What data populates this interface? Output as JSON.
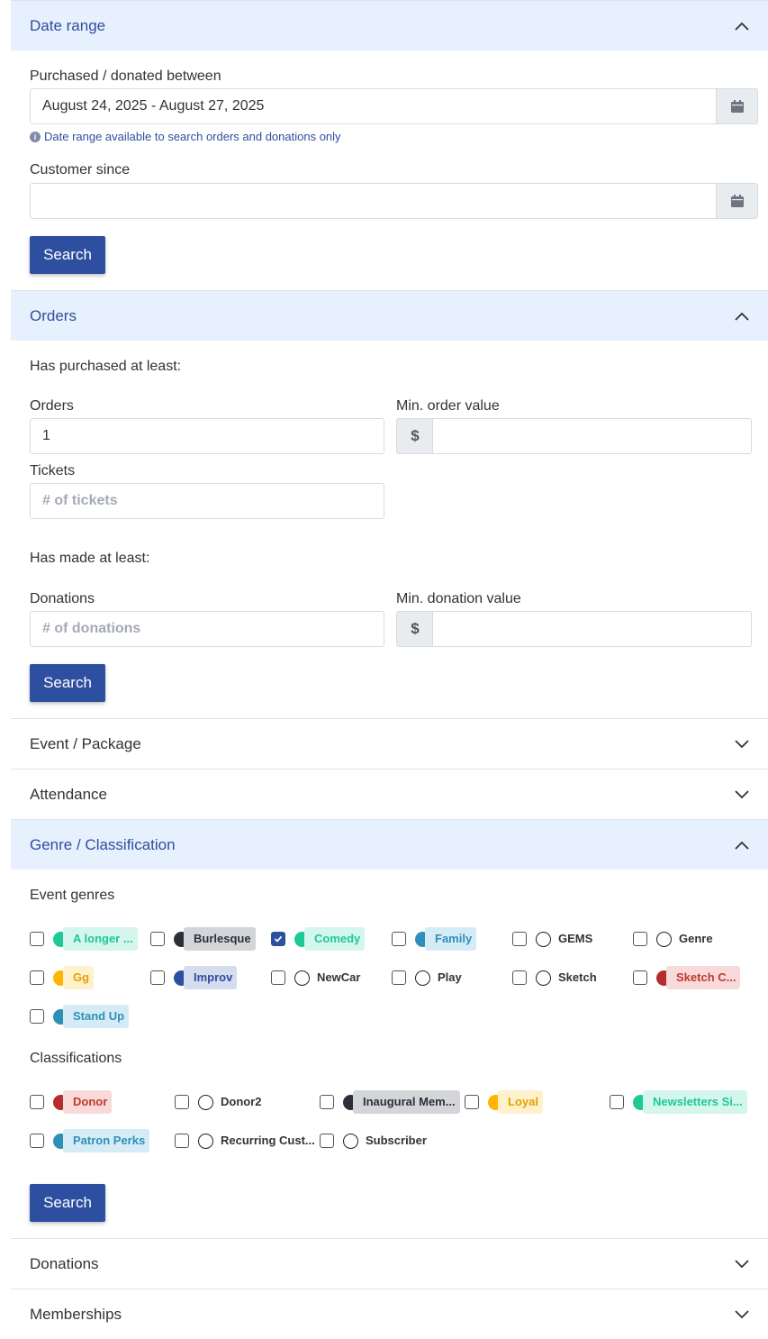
{
  "sections": {
    "date_range": {
      "title": "Date range"
    },
    "orders": {
      "title": "Orders"
    },
    "event_package": {
      "title": "Event / Package"
    },
    "attendance": {
      "title": "Attendance"
    },
    "genre": {
      "title": "Genre / Classification"
    },
    "donations": {
      "title": "Donations"
    },
    "memberships": {
      "title": "Memberships"
    }
  },
  "date_range": {
    "purchased_label": "Purchased / donated between",
    "purchased_value": "August 24, 2025 - August 27, 2025",
    "hint": "Date range available to search orders and donations only",
    "customer_since_label": "Customer since",
    "customer_since_value": "",
    "search_label": "Search"
  },
  "orders": {
    "purchased_heading": "Has purchased at least:",
    "orders_label": "Orders",
    "orders_value": "1",
    "min_order_label": "Min. order value",
    "currency_symbol": "$",
    "tickets_label": "Tickets",
    "tickets_placeholder": "# of tickets",
    "made_heading": "Has made at least:",
    "donations_label": "Donations",
    "donations_placeholder": "# of donations",
    "min_donation_label": "Min. donation value",
    "search_label": "Search"
  },
  "genre": {
    "event_genres_label": "Event genres",
    "classifications_label": "Classifications",
    "search_label": "Search",
    "event_genres": [
      {
        "label": "A longer ...",
        "color": "#1ec997",
        "bg": "#d5f6ec",
        "text": "#1ec997",
        "checked": false
      },
      {
        "label": "Burlesque",
        "color": "#2b3038",
        "bg": "#d3d5d9",
        "text": "#2b3038",
        "checked": false
      },
      {
        "label": "Comedy",
        "color": "#1ec997",
        "bg": "#d5f6ec",
        "text": "#1ec997",
        "checked": true
      },
      {
        "label": "Family",
        "color": "#2e90b8",
        "bg": "#d5ecf6",
        "text": "#2e90b8",
        "checked": false
      },
      {
        "label": "GEMS",
        "color": "",
        "bg": "",
        "text": "#333333",
        "checked": false
      },
      {
        "label": "Genre",
        "color": "",
        "bg": "",
        "text": "#333333",
        "checked": false
      },
      {
        "label": "Gg",
        "color": "#ffb400",
        "bg": "#fff1cc",
        "text": "#e3a100",
        "checked": false
      },
      {
        "label": "Improv",
        "color": "#2e4ea0",
        "bg": "#d5dcee",
        "text": "#2e4ea0",
        "checked": false
      },
      {
        "label": "NewCar",
        "color": "",
        "bg": "",
        "text": "#333333",
        "checked": false
      },
      {
        "label": "Play",
        "color": "",
        "bg": "",
        "text": "#333333",
        "checked": false
      },
      {
        "label": "Sketch",
        "color": "",
        "bg": "",
        "text": "#333333",
        "checked": false
      },
      {
        "label": "Sketch C...",
        "color": "#b52d2d",
        "bg": "#f8dada",
        "text": "#c0392b",
        "checked": false
      },
      {
        "label": "Stand Up",
        "color": "#2e90b8",
        "bg": "#d5ecf6",
        "text": "#2e90b8",
        "checked": false
      }
    ],
    "classifications": [
      {
        "label": "Donor",
        "color": "#b52d2d",
        "bg": "#f8dada",
        "text": "#c0392b",
        "checked": false
      },
      {
        "label": "Donor2",
        "color": "",
        "bg": "",
        "text": "#333333",
        "checked": false
      },
      {
        "label": "Inaugural Mem...",
        "color": "#2b3038",
        "bg": "#d3d5d9",
        "text": "#2b3038",
        "checked": false
      },
      {
        "label": "Loyal",
        "color": "#ffb400",
        "bg": "#fff1cc",
        "text": "#e3a100",
        "checked": false
      },
      {
        "label": "Newsletters Si...",
        "color": "#1ec997",
        "bg": "#d5f6ec",
        "text": "#1ec997",
        "checked": false
      },
      {
        "label": "Patron Perks",
        "color": "#2e90b8",
        "bg": "#d5ecf6",
        "text": "#2e90b8",
        "checked": false
      },
      {
        "label": "Recurring Cust...",
        "color": "",
        "bg": "",
        "text": "#333333",
        "checked": false
      },
      {
        "label": "Subscriber",
        "color": "",
        "bg": "",
        "text": "#333333",
        "checked": false
      }
    ]
  },
  "colors": {
    "primary": "#2e4ea0",
    "section_open_bg": "#e7f0fd"
  }
}
